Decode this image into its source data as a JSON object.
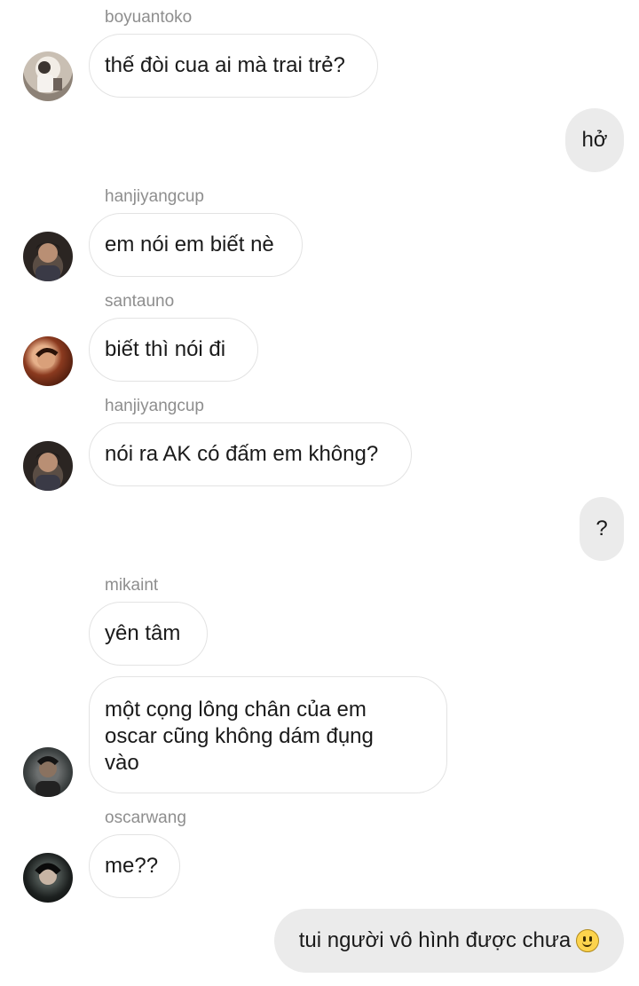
{
  "colors": {
    "incoming_bubble_bg": "#ffffff",
    "incoming_bubble_border": "#e3e3e3",
    "outgoing_bubble_bg": "#ebebeb",
    "username_text": "#8e8e8e",
    "message_text": "#1a1a1a"
  },
  "messages": [
    {
      "sender": "boyuantoko",
      "text": "thế đòi cua ai mà trai trẻ?",
      "direction": "incoming",
      "avatar": "photo-avatar"
    },
    {
      "text": "hở",
      "direction": "outgoing"
    },
    {
      "sender": "hanjiyangcup",
      "text": "em nói em biết nè",
      "direction": "incoming",
      "avatar": "photo-avatar"
    },
    {
      "sender": "santauno",
      "text": "biết thì nói đi",
      "direction": "incoming",
      "avatar": "photo-avatar"
    },
    {
      "sender": "hanjiyangcup",
      "text": "nói ra AK có đấm em không?",
      "direction": "incoming",
      "avatar": "photo-avatar"
    },
    {
      "text": "?",
      "direction": "outgoing"
    },
    {
      "sender": "mikaint",
      "text": "yên tâm",
      "direction": "incoming"
    },
    {
      "text": "một cọng lông chân của em oscar cũng không dám đụng vào",
      "direction": "incoming",
      "avatar": "photo-avatar"
    },
    {
      "sender": "oscarwang",
      "text": "me??",
      "direction": "incoming",
      "avatar": "photo-avatar"
    },
    {
      "text": "tui người vô hình được chưa",
      "direction": "outgoing",
      "emoji": "slightly-smiling-face-icon"
    }
  ]
}
